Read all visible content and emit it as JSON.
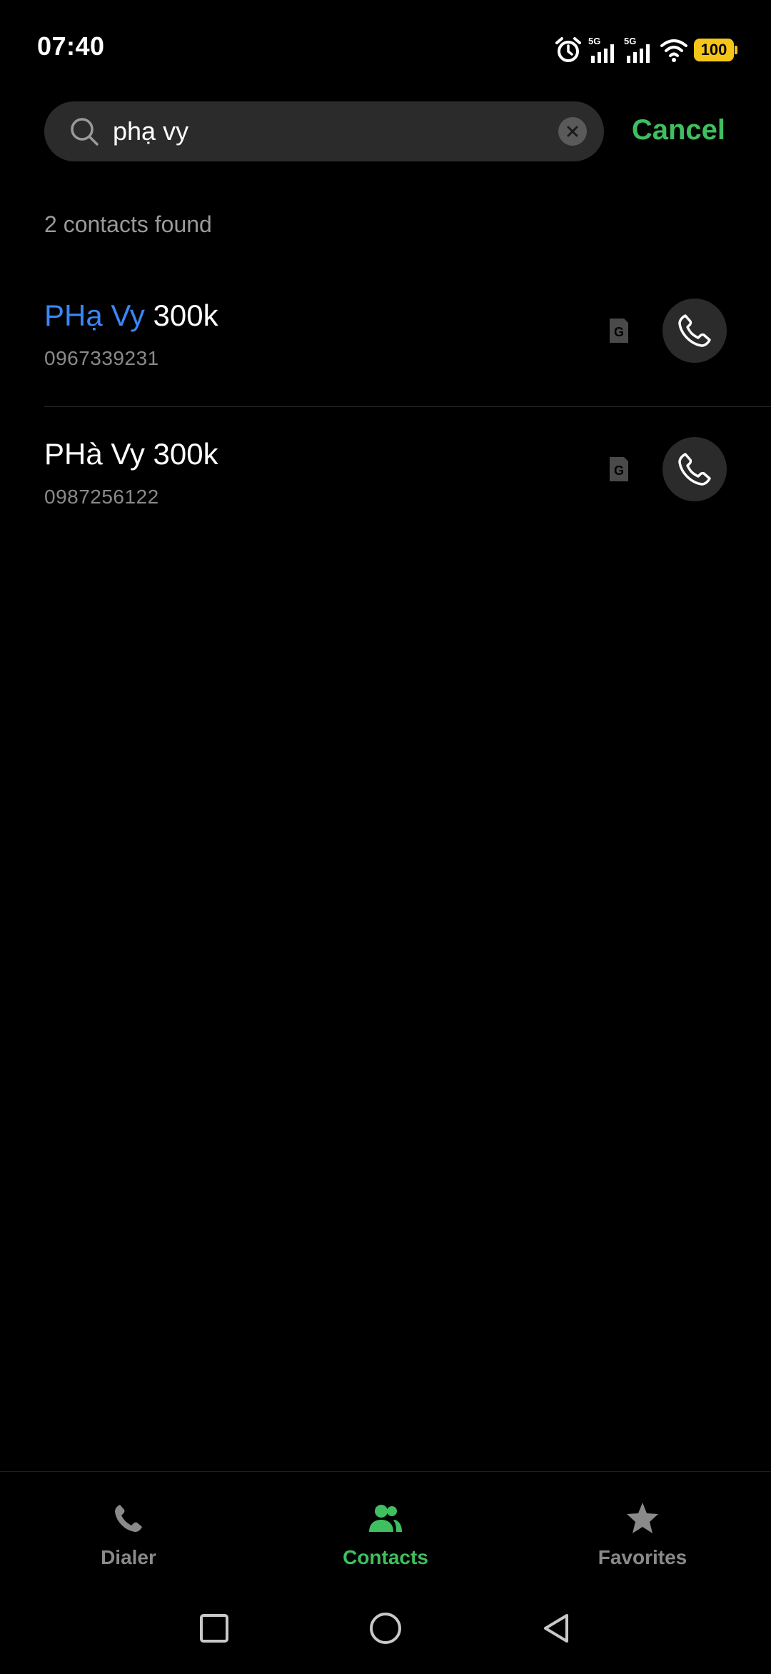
{
  "status_bar": {
    "time": "07:40",
    "battery": "100",
    "icons": [
      "alarm-icon",
      "signal-5g-icon",
      "signal-5g-icon",
      "wifi-icon",
      "battery-icon"
    ],
    "network_label_1": "5G",
    "network_label_2": "5G",
    "battery_color": "#f5c518"
  },
  "search": {
    "value": "phạ vy",
    "cancel_label": "Cancel"
  },
  "results": {
    "count_text": "2 contacts found",
    "contacts": [
      {
        "name_highlight": "PHạ Vy",
        "name_rest": " 300k",
        "phone": "0967339231",
        "sim_label": "G",
        "icon": "phone-icon"
      },
      {
        "name_highlight": "",
        "name_rest": "PHà Vy 300k",
        "phone": "0987256122",
        "sim_label": "G",
        "icon": "phone-icon"
      }
    ]
  },
  "tabs": [
    {
      "label": "Dialer",
      "icon": "phone-icon",
      "active": false
    },
    {
      "label": "Contacts",
      "icon": "contacts-icon",
      "active": true
    },
    {
      "label": "Favorites",
      "icon": "star-icon",
      "active": false
    }
  ],
  "nav": [
    "recents-icon",
    "home-icon",
    "back-icon"
  ],
  "colors": {
    "accent": "#3fbf5f",
    "highlight": "#3a86f5",
    "background": "#000000"
  }
}
